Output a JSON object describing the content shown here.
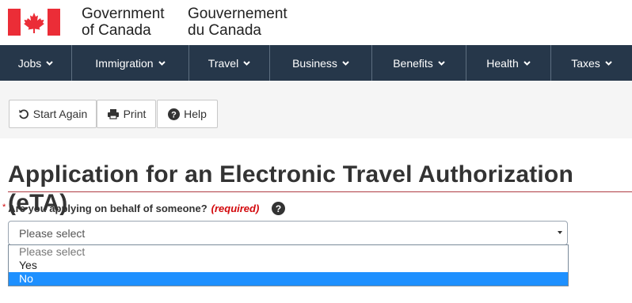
{
  "header": {
    "signature_en_line1": "Government",
    "signature_en_line2": "of Canada",
    "signature_fr_line1": "Gouvernement",
    "signature_fr_line2": "du Canada",
    "flag_color": "#eb2d37"
  },
  "nav": {
    "items": [
      {
        "label": "Jobs"
      },
      {
        "label": "Immigration"
      },
      {
        "label": "Travel"
      },
      {
        "label": "Business"
      },
      {
        "label": "Benefits"
      },
      {
        "label": "Health"
      },
      {
        "label": "Taxes"
      }
    ],
    "background": "#26374a"
  },
  "toolbar": {
    "start_again_label": "Start Again",
    "print_label": "Print",
    "help_label": "Help"
  },
  "page": {
    "title": "Application for an Electronic Travel Authorization (eTA)"
  },
  "question": {
    "required_marker": "*",
    "label": "Are you applying on behalf of someone?",
    "required_text": "(required)",
    "help_icon": "question-circle-icon"
  },
  "select": {
    "current_value": "Please select",
    "options": [
      "Please select",
      "Yes",
      "No"
    ],
    "highlighted_option": "No"
  }
}
